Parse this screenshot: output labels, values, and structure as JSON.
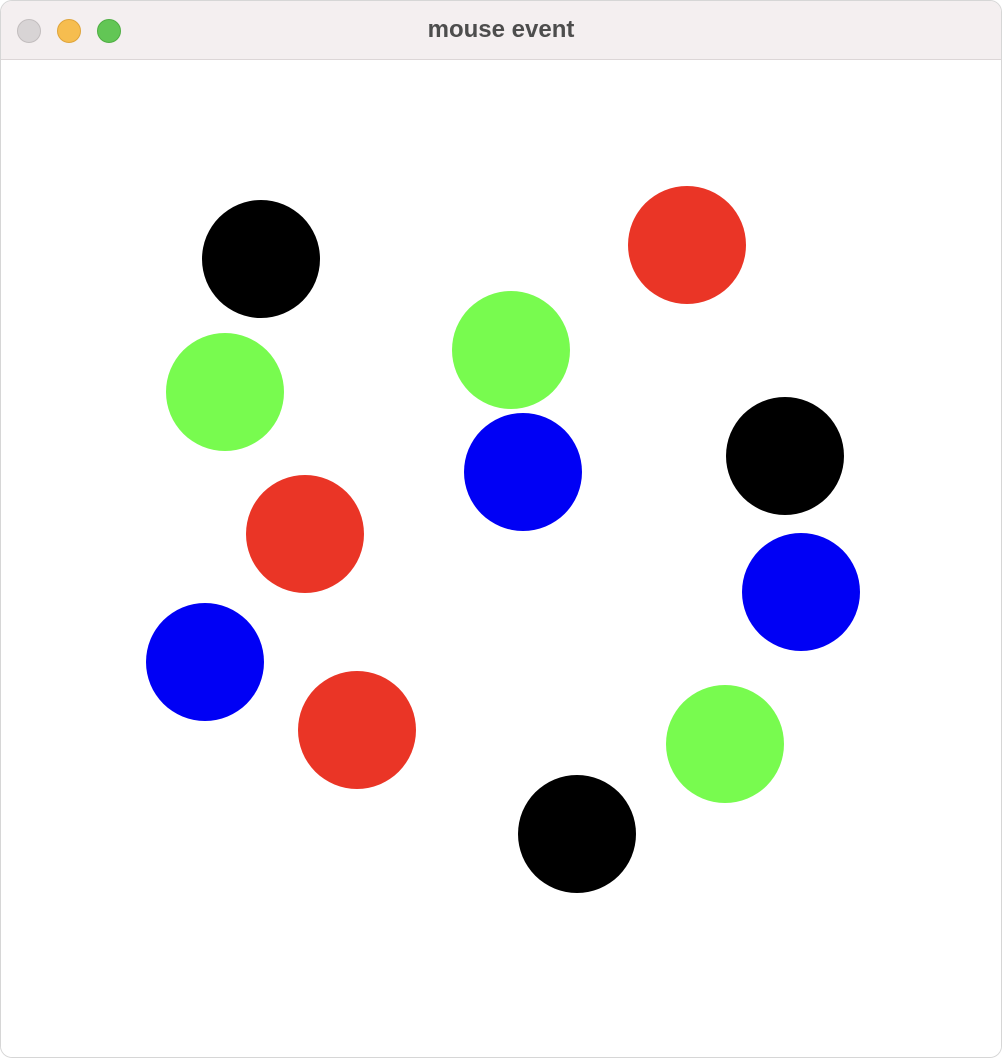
{
  "window": {
    "title": "mouse event"
  },
  "colors": {
    "red": "#ea3526",
    "green": "#78fb4f",
    "blue": "#0000f5",
    "black": "#000000"
  },
  "canvas": {
    "circles": [
      {
        "color": "black"
      },
      {
        "color": "red"
      },
      {
        "color": "green"
      },
      {
        "color": "green"
      },
      {
        "color": "blue"
      },
      {
        "color": "black"
      },
      {
        "color": "red"
      },
      {
        "color": "blue"
      },
      {
        "color": "blue"
      },
      {
        "color": "red"
      },
      {
        "color": "green"
      },
      {
        "color": "black"
      }
    ]
  }
}
